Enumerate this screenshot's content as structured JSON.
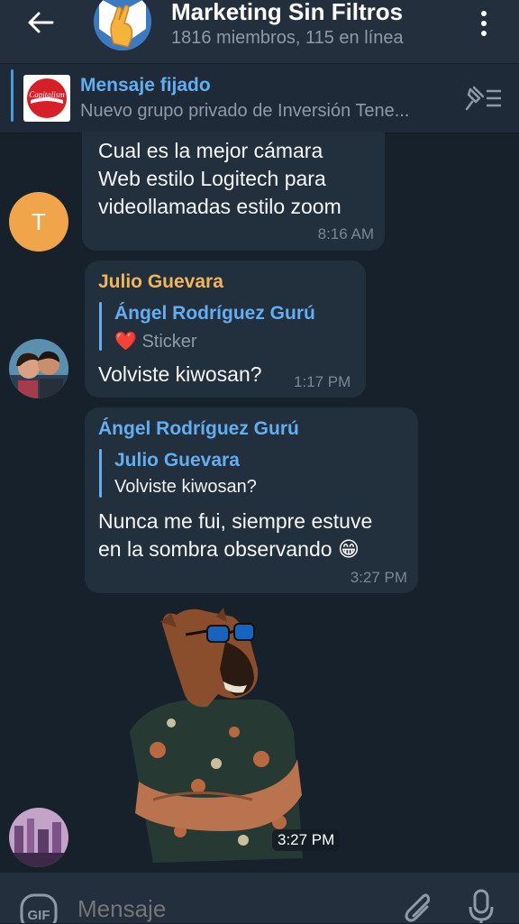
{
  "header": {
    "title": "Marketing Sin Filtros",
    "subtitle": "1816 miembros, 115 en línea"
  },
  "pinned": {
    "title": "Mensaje fijado",
    "text": "Nuevo grupo privado de Inversión  Tene...",
    "thumb_text": "Capitalism"
  },
  "messages": [
    {
      "avatar_letter": "T",
      "avatar_color": "#f0a54a",
      "lines": [
        "Cual es la mejor cámara",
        "Web estilo Logitech para",
        "videollamadas estilo zoom"
      ],
      "time": "8:16 AM"
    },
    {
      "sender": "Julio Guevara",
      "sender_color": "#f2b65a",
      "reply_name": "Ángel Rodríguez Gurú",
      "reply_emoji": "❤️",
      "reply_text": "Sticker",
      "text": "Volviste kiwosan?",
      "time": "1:17 PM"
    },
    {
      "sender": "Ángel Rodríguez Gurú",
      "sender_color": "#63aef0",
      "reply_name": "Julio Guevara",
      "reply_text": "Volviste kiwosan?",
      "lines": [
        "Nunca me fui, siempre estuve",
        "en la sombra observando"
      ],
      "emoji": "😁",
      "time": "3:27 PM"
    },
    {
      "type": "sticker",
      "time": "3:27 PM"
    }
  ],
  "composer": {
    "gif_label": "GIF",
    "placeholder": "Mensaje"
  }
}
